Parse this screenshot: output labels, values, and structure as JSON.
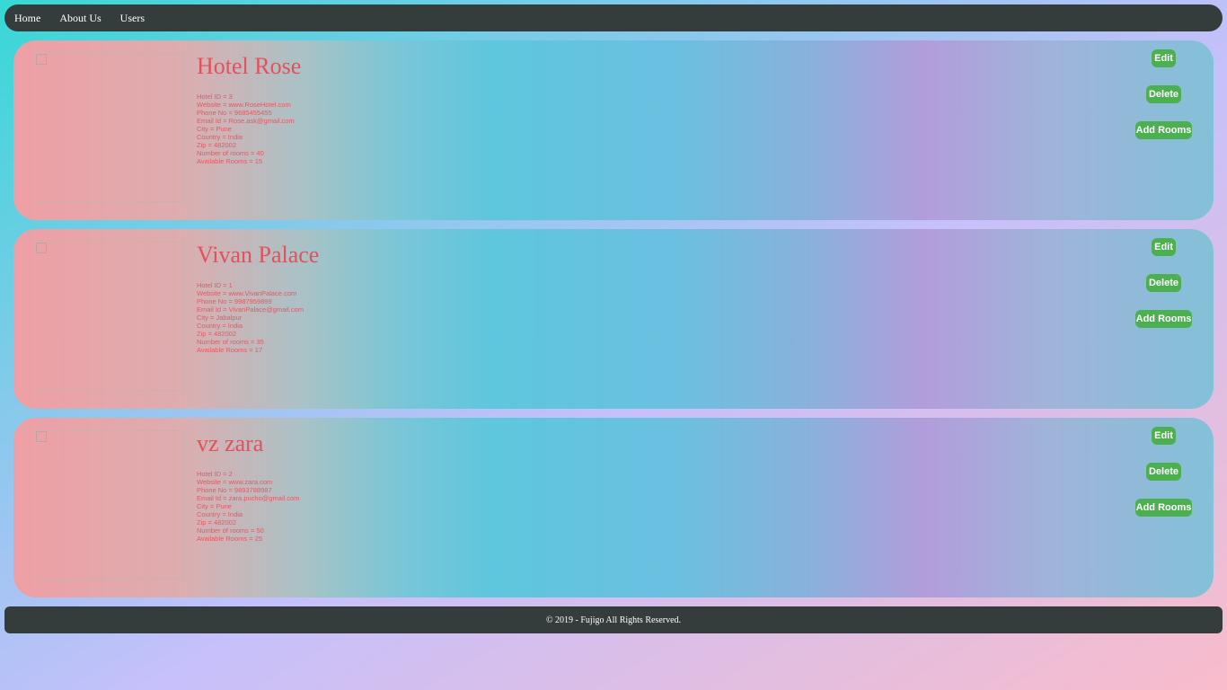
{
  "nav": {
    "items": [
      "Home",
      "About Us",
      "Users"
    ]
  },
  "buttons": {
    "edit": "Edit",
    "delete": "Delete",
    "add_rooms": "Add Rooms"
  },
  "hotels": [
    {
      "name": "Hotel Rose",
      "details": [
        "Hotel ID = 3",
        "Website = www.RoseHotel.com",
        "Phone No = 9685455455",
        "Email Id = Rose.ask@gmail.com",
        "City = Pune",
        "Country = India",
        "Zip = 482002",
        "Number of rooms = 40",
        "Available Rooms = 15"
      ]
    },
    {
      "name": "Vivan Palace",
      "details": [
        "Hotel ID = 1",
        "Website = www.VivanPalace.com",
        "Phone No = 9987959899",
        "Email Id = VivanPalace@gmail.com",
        "City = Jabalpur",
        "Country = India",
        "Zip = 482002",
        "Number of rooms = 35",
        "Available Rooms = 17"
      ]
    },
    {
      "name": "vz zara",
      "details": [
        "Hotel ID = 2",
        "Website = www.zara.com",
        "Phone No = 9893788987",
        "Email Id = zara.pucho@gmail.com",
        "City = Pune",
        "Country = India",
        "Zip = 482002",
        "Number of rooms = 50",
        "Available Rooms = 25"
      ]
    }
  ],
  "footer": {
    "text": "© 2019 - Fujigo All Rights Reserved."
  }
}
